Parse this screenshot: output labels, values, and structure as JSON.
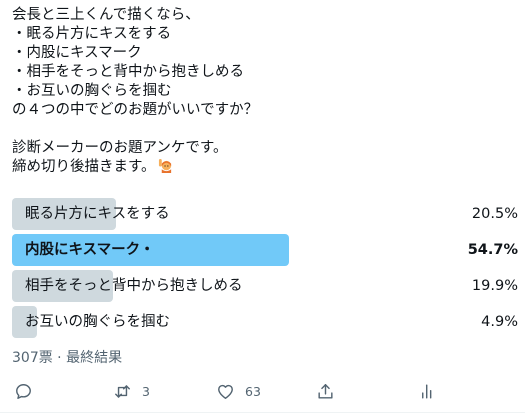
{
  "tweet": {
    "lines": [
      "会長と三上くんで描くなら、",
      "・眠る片方にキスをする",
      "・内股にキスマーク",
      "・相手をそっと背中から抱きしめる",
      "・お互いの胸ぐらを掴む",
      "の４つの中でどのお題がいいですか？",
      "",
      "診断メーカーのお題アンケです。",
      "締め切り後描きます。"
    ],
    "emoji": "raising-hand-emoji"
  },
  "poll": {
    "options": [
      {
        "label": "眠る片方にキスをする",
        "percent": "20.5%",
        "fraction": 0.205,
        "winner": false
      },
      {
        "label": "内股にキスマーク・",
        "percent": "54.7%",
        "fraction": 0.547,
        "winner": true
      },
      {
        "label": "相手をそっと背中から抱きしめる",
        "percent": "19.9%",
        "fraction": 0.199,
        "winner": false
      },
      {
        "label": "お互いの胸ぐらを掴む",
        "percent": "4.9%",
        "fraction": 0.049,
        "winner": false
      }
    ],
    "summary": "307票 · 最終結果"
  },
  "actions": {
    "reply": {
      "icon": "reply-icon",
      "count": ""
    },
    "retweet": {
      "icon": "retweet-icon",
      "count": "3"
    },
    "like": {
      "icon": "heart-icon",
      "count": "63"
    },
    "share": {
      "icon": "share-icon",
      "count": ""
    },
    "analytics": {
      "icon": "analytics-icon",
      "count": ""
    }
  },
  "colors": {
    "winner_bar": "#71c9f8",
    "other_bar": "#cfd9de",
    "secondary_text": "#536471"
  }
}
